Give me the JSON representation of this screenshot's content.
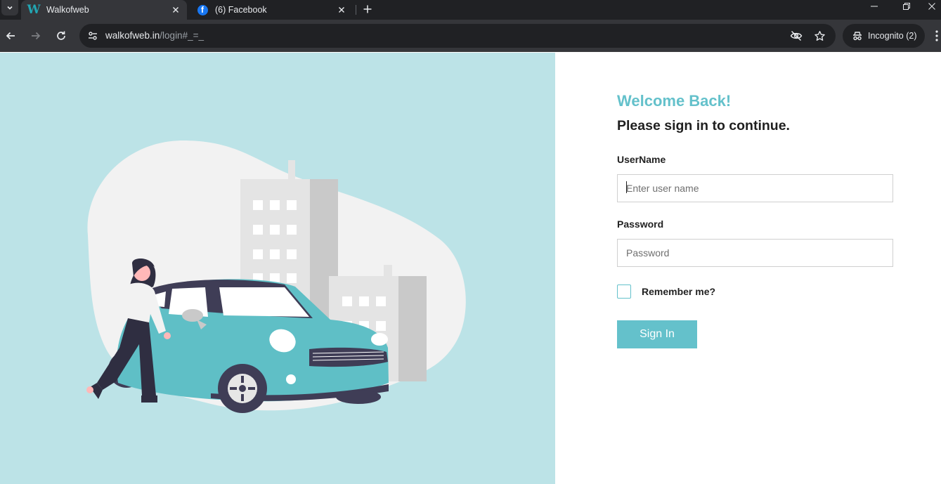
{
  "browser": {
    "tabs": [
      {
        "title": "Walkofweb",
        "favicon": "walkofweb-w-icon",
        "active": true
      },
      {
        "title": "(6) Facebook",
        "favicon": "facebook-icon",
        "active": false
      }
    ],
    "url_host": "walkofweb.in",
    "url_path": "/login#_=_",
    "incognito_label": "Incognito (2)",
    "accent_colors": {
      "chrome_dark": "#202124",
      "chrome_toolbar": "#35363a"
    }
  },
  "login": {
    "welcome": "Welcome Back!",
    "subtitle": "Please sign in to continue.",
    "username_label": "UserName",
    "username_placeholder": "Enter user name",
    "username_value": "",
    "password_label": "Password",
    "password_placeholder": "Password",
    "password_value": "",
    "remember_label": "Remember me?",
    "remember_checked": false,
    "signin_label": "Sign In"
  },
  "colors": {
    "accent": "#64c1cb",
    "left_panel_bg": "#bce3e7",
    "car": "#5fbfc6",
    "car_dark": "#3f3d56",
    "building_light": "#e4e4e4",
    "building_shade": "#c9c9c9",
    "blob": "#f2f2f2"
  }
}
